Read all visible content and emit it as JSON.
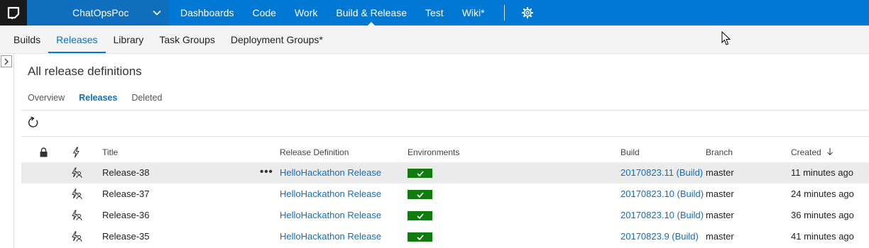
{
  "topbar": {
    "project": "ChatOpsPoc",
    "nav": [
      "Dashboards",
      "Code",
      "Work",
      "Build & Release",
      "Test",
      "Wiki*"
    ],
    "active_nav": "Build & Release",
    "icons": [
      "logo-icon",
      "chevron-down-icon",
      "gear-icon"
    ]
  },
  "subnav": {
    "items": [
      "Builds",
      "Releases",
      "Library",
      "Task Groups",
      "Deployment Groups*"
    ],
    "active": "Releases"
  },
  "page": {
    "title": "All release definitions",
    "tabs": [
      "Overview",
      "Releases",
      "Deleted"
    ],
    "active_tab": "Releases"
  },
  "table": {
    "columns": {
      "lock": "",
      "trigger": "",
      "title": "Title",
      "definition": "Release Definition",
      "environments": "Environments",
      "build": "Build",
      "branch": "Branch",
      "created": "Created"
    },
    "sort": "created-descending",
    "rows": [
      {
        "title": "Release-38",
        "definition": "HelloHackathon Release",
        "environment_status": "succeeded",
        "build": "20170823.11 (Build)",
        "branch": "master",
        "created": "11 minutes ago",
        "selected": true
      },
      {
        "title": "Release-37",
        "definition": "HelloHackathon Release",
        "environment_status": "succeeded",
        "build": "20170823.10 (Build)",
        "branch": "master",
        "created": "24 minutes ago",
        "selected": false
      },
      {
        "title": "Release-36",
        "definition": "HelloHackathon Release",
        "environment_status": "succeeded",
        "build": "20170823.10 (Build)",
        "branch": "master",
        "created": "36 minutes ago",
        "selected": false
      },
      {
        "title": "Release-35",
        "definition": "HelloHackathon Release",
        "environment_status": "succeeded",
        "build": "20170823.9 (Build)",
        "branch": "master",
        "created": "41 minutes ago",
        "selected": false
      }
    ]
  },
  "colors": {
    "topbar": "#0078d4",
    "project_bg": "#106ebe",
    "link": "#106ebe",
    "env_succeeded": "#107c10",
    "selected_row": "#ebebeb"
  }
}
